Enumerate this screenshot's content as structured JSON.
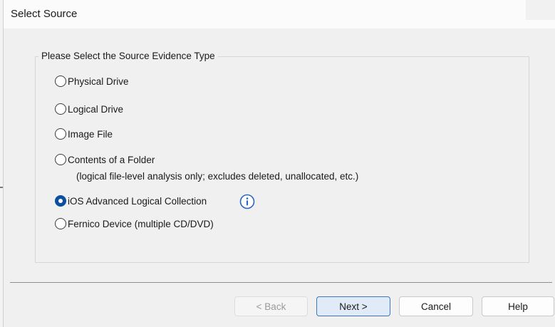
{
  "window": {
    "title": "Select Source"
  },
  "group": {
    "label": "Please Select the Source Evidence Type"
  },
  "options": [
    {
      "label": "Physical Drive",
      "checked": false
    },
    {
      "label": "Logical Drive",
      "checked": false
    },
    {
      "label": "Image File",
      "checked": false
    },
    {
      "label": "Contents of a Folder",
      "checked": false
    },
    {
      "label": "iOS Advanced Logical Collection",
      "checked": true
    },
    {
      "label": "Fernico Device (multiple CD/DVD)",
      "checked": false
    }
  ],
  "folder_note": "(logical file-level analysis only; excludes deleted, unallocated, etc.)",
  "info_icon": "info-circle-icon",
  "buttons": {
    "back": "< Back",
    "next": "Next >",
    "cancel": "Cancel",
    "help": "Help"
  },
  "colors": {
    "accent": "#0b4ea2",
    "primary_button_border": "#3d77c2"
  }
}
